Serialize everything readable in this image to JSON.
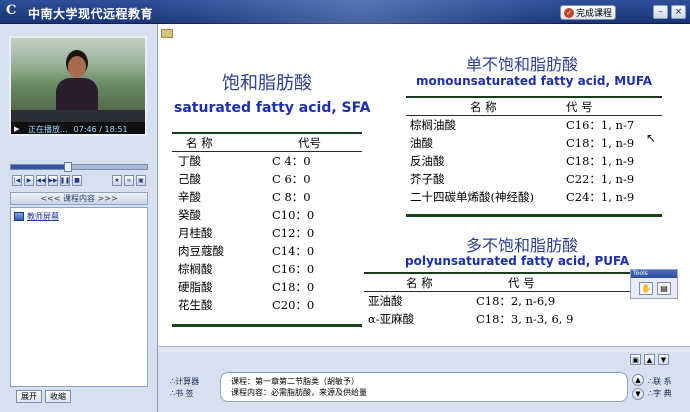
{
  "header": {
    "logo": "C",
    "title": "中南大学现代远程教育",
    "finish_label": "完成课程"
  },
  "player": {
    "status": "正在播放...",
    "time": "07:46 / 18:51",
    "progress": 0.42
  },
  "left_panel": {
    "content_header": "<<< 课程内容 >>>",
    "tree_item": "教师屏幕",
    "expand_label": "展开",
    "collapse_label": "收缩"
  },
  "slide": {
    "saturated": {
      "title_cn": "饱和脂肪酸",
      "title_en": "saturated fatty acid, SFA",
      "headers": [
        "名  称",
        "代号"
      ],
      "rows": [
        [
          "丁酸",
          "C 4：0"
        ],
        [
          "己酸",
          "C 6：0"
        ],
        [
          "辛酸",
          "C 8：0"
        ],
        [
          "癸酸",
          "C10：0"
        ],
        [
          "月桂酸",
          "C12：0"
        ],
        [
          "肉豆蔻酸",
          "C14：0"
        ],
        [
          "棕榈酸",
          "C16：0"
        ],
        [
          "硬脂酸",
          "C18：0"
        ],
        [
          "花生酸",
          "C20：0"
        ]
      ]
    },
    "mono": {
      "title_cn": "单不饱和脂肪酸",
      "title_en": "monounsaturated fatty acid, MUFA",
      "headers": [
        "名  称",
        "代  号"
      ],
      "rows": [
        [
          "棕榈油酸",
          "C16：1, n-7"
        ],
        [
          "油酸",
          "C18：1, n-9"
        ],
        [
          "反油酸",
          "C18：1, n-9"
        ],
        [
          "芥子酸",
          "C22：1, n-9"
        ],
        [
          "二十四碳单烯酸(神经酸)",
          "C24：1, n-9"
        ]
      ]
    },
    "poly": {
      "title_cn": "多不饱和脂肪酸",
      "title_en": "polyunsaturated fatty acid, PUFA",
      "headers": [
        "名  称",
        "代  号"
      ],
      "rows": [
        [
          "亚油酸",
          "C18：2, n-6,9"
        ],
        [
          "α-亚麻酸",
          "C18：3, n-3, 6, 9"
        ]
      ]
    },
    "tools_label": "Tools"
  },
  "info": {
    "calculator": "∴计算器",
    "bookmark": "∴书  签",
    "course_line": "课程：第一章第二节脂类（胡敏予）",
    "content_line": "课程内容：必需脂肪酸，来源及供给量",
    "contact": "∴联  系",
    "dictionary": "∴字  典"
  }
}
